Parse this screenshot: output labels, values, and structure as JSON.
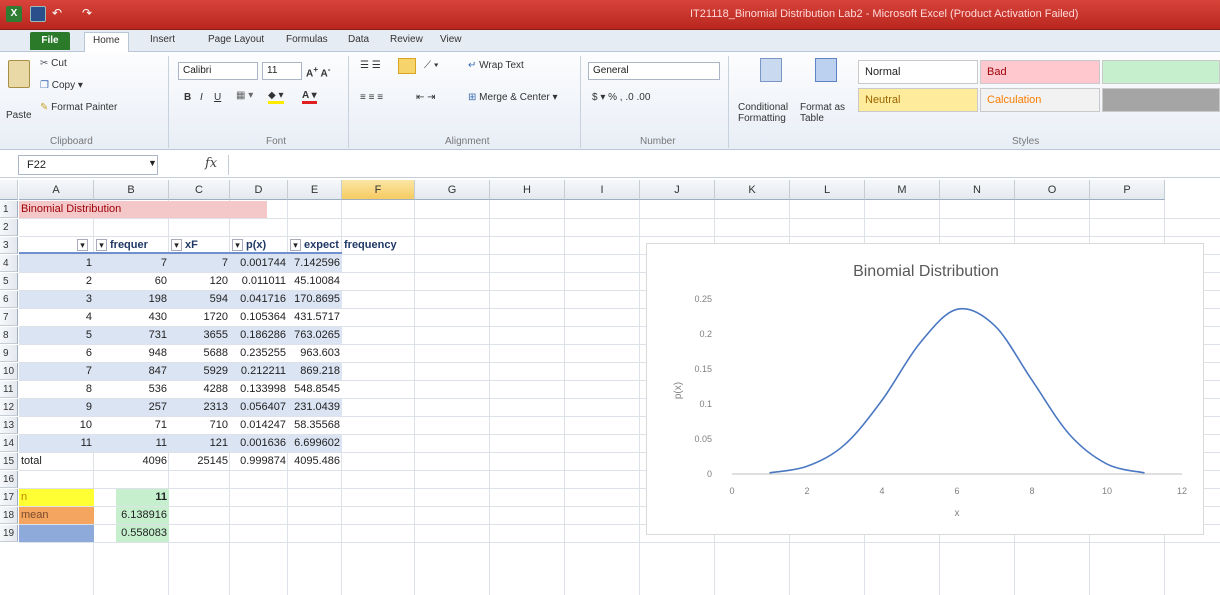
{
  "window": {
    "title": "IT21118_Binomial Distribution Lab2 - Microsoft Excel (Product Activation Failed)"
  },
  "ribbon_tabs": [
    "File",
    "Home",
    "Insert",
    "Page Layout",
    "Formulas",
    "Data",
    "Review",
    "View"
  ],
  "ribbon": {
    "clipboard": {
      "paste": "Paste",
      "cut": "Cut",
      "copy": "Copy",
      "format_painter": "Format Painter",
      "group": "Clipboard"
    },
    "font": {
      "name": "Calibri",
      "size": "11",
      "group": "Font"
    },
    "alignment": {
      "wrap": "Wrap Text",
      "merge": "Merge & Center",
      "group": "Alignment"
    },
    "number": {
      "format": "General",
      "group": "Number"
    },
    "styles": {
      "conditional": "Conditional Formatting",
      "format_table": "Format as Table",
      "normal": "Normal",
      "bad": "Bad",
      "neutral": "Neutral",
      "calculation": "Calculation",
      "group": "Styles"
    }
  },
  "formula_bar": {
    "name_box": "F22",
    "fx": "fx",
    "value": ""
  },
  "columns": [
    "A",
    "B",
    "C",
    "D",
    "E",
    "F",
    "G",
    "H",
    "I",
    "J",
    "K",
    "L",
    "M",
    "N",
    "O",
    "P"
  ],
  "rows": [
    "1",
    "2",
    "3",
    "4",
    "5",
    "6",
    "7",
    "8",
    "9",
    "10",
    "11",
    "12",
    "13",
    "14",
    "15",
    "16",
    "17",
    "18",
    "19"
  ],
  "sheet": {
    "title": "Binomial Distribution",
    "headers": [
      "",
      "frequer",
      "xF",
      "p(x)",
      "expect",
      "frequency"
    ],
    "rows": [
      [
        "1",
        "7",
        "7",
        "0.001744",
        "7.142596"
      ],
      [
        "2",
        "60",
        "120",
        "0.011011",
        "45.10084"
      ],
      [
        "3",
        "198",
        "594",
        "0.041716",
        "170.8695"
      ],
      [
        "4",
        "430",
        "1720",
        "0.105364",
        "431.5717"
      ],
      [
        "5",
        "731",
        "3655",
        "0.186286",
        "763.0265"
      ],
      [
        "6",
        "948",
        "5688",
        "0.235255",
        "963.603"
      ],
      [
        "7",
        "847",
        "5929",
        "0.212211",
        "869.218"
      ],
      [
        "8",
        "536",
        "4288",
        "0.133998",
        "548.8545"
      ],
      [
        "9",
        "257",
        "2313",
        "0.056407",
        "231.0439"
      ],
      [
        "10",
        "71",
        "710",
        "0.014247",
        "58.35568"
      ],
      [
        "11",
        "11",
        "121",
        "0.001636",
        "6.699602"
      ]
    ],
    "total": [
      "total",
      "4096",
      "25145",
      "0.999874",
      "4095.486"
    ],
    "params": [
      {
        "label": "n",
        "value": "11"
      },
      {
        "label": "mean",
        "value": "6.138916"
      },
      {
        "label": "",
        "value": "0.558083"
      }
    ]
  },
  "chart_data": {
    "type": "line",
    "title": "Binomial Distribution",
    "xlabel": "x",
    "ylabel": "p(x)",
    "xlim": [
      0,
      12
    ],
    "ylim": [
      0,
      0.25
    ],
    "xticks": [
      "0",
      "2",
      "4",
      "6",
      "8",
      "10",
      "12"
    ],
    "yticks": [
      "0",
      "0.05",
      "0.1",
      "0.15",
      "0.2",
      "0.25"
    ],
    "x": [
      1,
      2,
      3,
      4,
      5,
      6,
      7,
      8,
      9,
      10,
      11
    ],
    "series": [
      {
        "values": [
          0.001744,
          0.011011,
          0.041716,
          0.105364,
          0.186286,
          0.235255,
          0.212211,
          0.133998,
          0.056407,
          0.014247,
          0.001636
        ]
      }
    ],
    "grid": false,
    "line_color": "#4a78c2"
  },
  "colors": {
    "title_bar": "#c0302a",
    "title_cell_fill": "#f4c7c9",
    "table_band": "#dbe4f3",
    "table_header_border": "#6e8fd0",
    "n_fill": "#ffff33",
    "mean_fill": "#f4a560",
    "value_fill": "#c6efce",
    "blue_fill": "#8eaadb"
  }
}
